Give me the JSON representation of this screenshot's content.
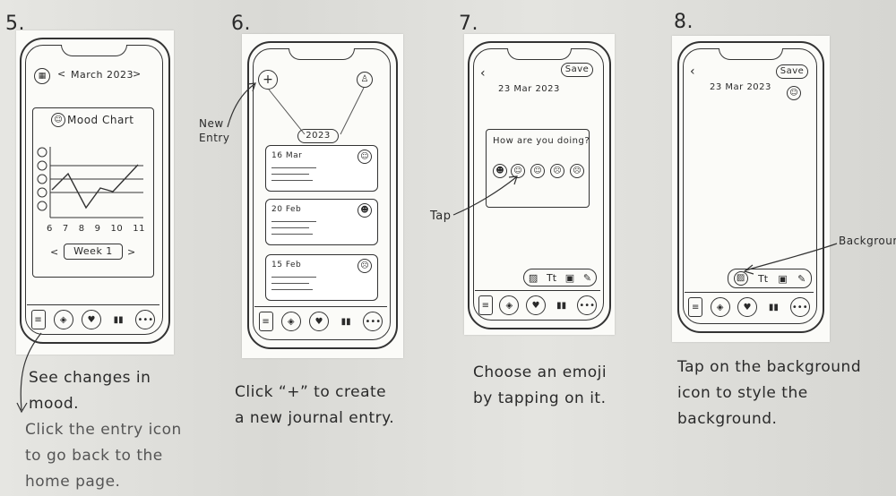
{
  "steps": [
    {
      "number": "5.",
      "header": {
        "month": "March 2023",
        "prev": "<",
        "next": ">"
      },
      "mood_chart": {
        "title": "Mood Chart",
        "x_ticks": [
          "6",
          "7",
          "8",
          "9",
          "10",
          "11"
        ],
        "week_label": "Week 1",
        "prev": "<",
        "next": ">"
      },
      "caption": [
        "See changes in",
        "mood."
      ],
      "caption2": [
        "Click the entry icon",
        "to go back to the",
        "home page."
      ]
    },
    {
      "number": "6.",
      "new_entry_label": [
        "New",
        "Entry"
      ],
      "year": "2023",
      "entries": [
        "16 Mar",
        "20 Feb",
        "15 Feb"
      ],
      "caption": [
        "Click “+” to create",
        "a new journal entry."
      ]
    },
    {
      "number": "7.",
      "save": "Save",
      "date": "23 Mar 2023",
      "question": "How are you doing?",
      "tap_label": "Tap",
      "caption": [
        "Choose an emoji",
        "by tapping on it."
      ]
    },
    {
      "number": "8.",
      "save": "Save",
      "date": "23 Mar 2023",
      "background_label": "Background",
      "caption": [
        "Tap on the background",
        "icon to style the",
        "background."
      ]
    }
  ],
  "icons": [
    "entry-icon",
    "compass-icon",
    "heart-icon",
    "bar-chart-icon",
    "more-icon"
  ]
}
